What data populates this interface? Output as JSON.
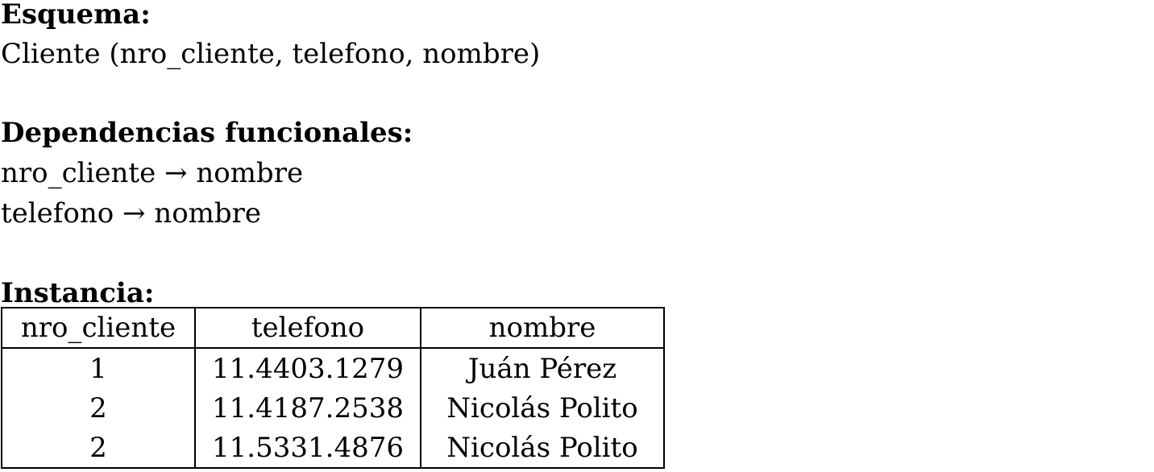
{
  "schema": {
    "heading": "Esquema:",
    "relation": "Cliente (nro_cliente, telefono, nombre)"
  },
  "dependencies": {
    "heading": "Dependencias funcionales:",
    "items": [
      "nro_cliente → nombre",
      "telefono → nombre"
    ]
  },
  "instance": {
    "heading": "Instancia:",
    "columns": [
      "nro_cliente",
      "telefono",
      "nombre"
    ],
    "rows": [
      [
        "1",
        "11.4403.1279",
        "Juán Pérez"
      ],
      [
        "2",
        "11.4187.2538",
        "Nicolás Polito"
      ],
      [
        "2",
        "11.5331.4876",
        "Nicolás Polito"
      ]
    ]
  }
}
